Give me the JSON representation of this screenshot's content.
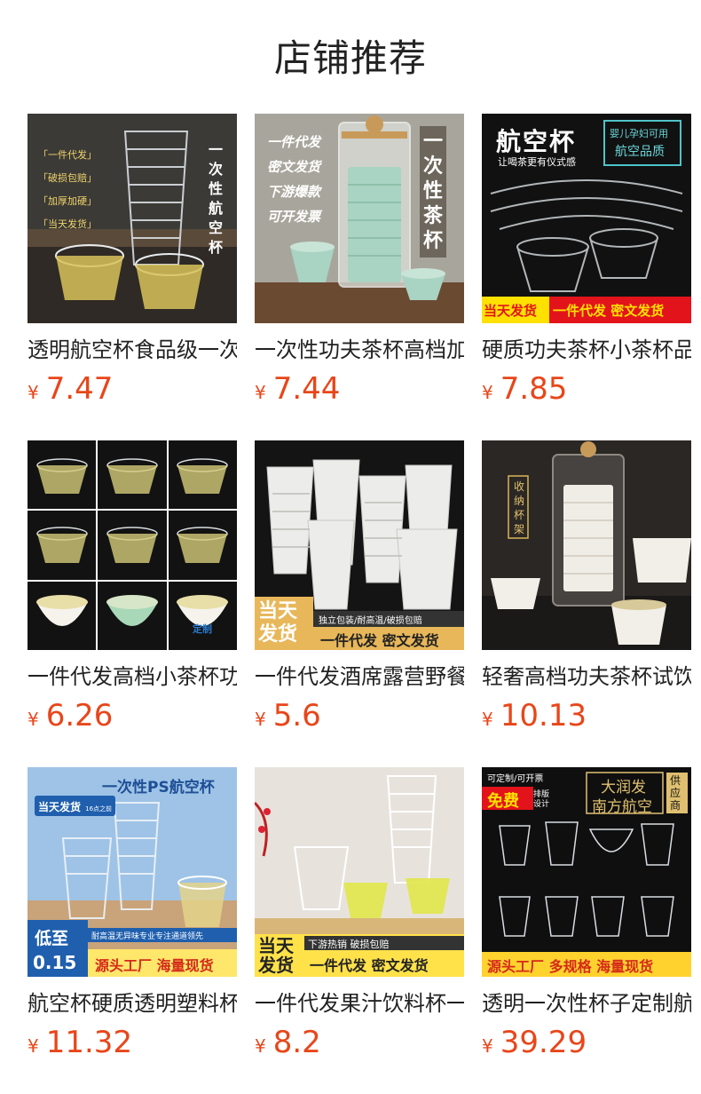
{
  "page": {
    "title": "店铺推荐"
  },
  "currency_symbol": "¥",
  "products": [
    {
      "name": "透明航空杯食品级一次性",
      "price": "7.47",
      "image_text": [
        "一",
        "次",
        "性",
        "航",
        "空",
        "杯"
      ],
      "image_tags": [
        "「一件代发」",
        "「破损包赔」",
        "「加厚加硬」",
        "「当天发货」"
      ]
    },
    {
      "name": "一次性功夫茶杯高档加厚",
      "price": "7.44",
      "image_text": [
        "一",
        "次",
        "性",
        "茶",
        "杯"
      ],
      "image_tags": [
        "一件代发",
        "密文发货",
        "下游爆款",
        "可开发票"
      ]
    },
    {
      "name": "硬质功夫茶杯小茶杯品茗",
      "price": "7.85",
      "image_title": "航空杯",
      "image_subtitle": "让喝茶更有仪式感",
      "image_badge_1": "婴儿孕妇可用",
      "image_badge_2": "航空品质",
      "image_footer_1": "当天发货",
      "image_footer_2": "一件代发 密文发货"
    },
    {
      "name": "一件代发高档小茶杯功夫",
      "price": "6.26",
      "image_tag": "定制"
    },
    {
      "name": "一件代发酒席露营野餐杯",
      "price": "5.6",
      "image_badge": "当天发货",
      "image_line_1": "独立包装/耐高温/破损包赔",
      "image_line_2": "一件代发 密文发货"
    },
    {
      "name": "轻奢高档功夫茶杯试饮杯",
      "price": "10.13",
      "image_text": [
        "收",
        "纳",
        "杯",
        "架"
      ]
    },
    {
      "name": "航空杯硬质透明塑料杯子",
      "price": "11.32",
      "image_title": "一次性PS航空杯",
      "image_badge": "当天发货",
      "image_badge_small": "16点之前",
      "image_low_1": "低至",
      "image_low_2": "0.15",
      "image_line_1": "耐高温无异味专业专注通道领先",
      "image_line_2": "源头工厂 海量现货"
    },
    {
      "name": "一件代发果汁饮料杯一次性",
      "price": "8.2",
      "image_badge": "当天发货",
      "image_line_1": "下游热销 破损包赔",
      "image_line_2": "一件代发 密文发货"
    },
    {
      "name": "透明一次性杯子定制航空杯",
      "price": "39.29",
      "image_top": "可定制/可开票",
      "image_free": "免费",
      "image_free_2": "排版设计",
      "image_brand_1": "大润发",
      "image_brand_2": "南方航空",
      "image_supply": "供应商",
      "image_footer": "源头工厂 多规格 海量现货"
    }
  ]
}
